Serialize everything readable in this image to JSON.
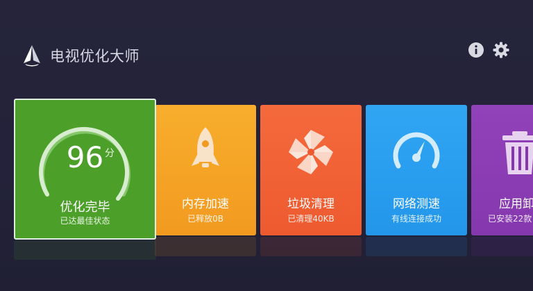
{
  "header": {
    "title": "电视优化大师",
    "logo_icon": "paper-boat-icon"
  },
  "top_actions": {
    "info_icon": "info-icon",
    "settings_icon": "gear-icon"
  },
  "cards": {
    "optimize": {
      "score": "96",
      "score_unit": "分",
      "score_value": 96,
      "label": "优化完毕",
      "sub": "已达最佳状态",
      "color": "#4ca02a"
    },
    "memory": {
      "label": "内存加速",
      "sub": "已释放0B",
      "icon": "rocket-icon",
      "color": "#f5a623"
    },
    "junk": {
      "label": "垃圾清理",
      "sub": "已清理40KB",
      "icon": "pinwheel-icon",
      "color": "#f0603a"
    },
    "speed": {
      "label": "网络测速",
      "sub": "有线连接成功",
      "icon": "speedometer-icon",
      "color": "#2a9ef0"
    },
    "uninstall": {
      "label": "应用卸",
      "sub": "已安装22款",
      "icon": "trash-icon",
      "color": "#8a3cb2"
    }
  }
}
